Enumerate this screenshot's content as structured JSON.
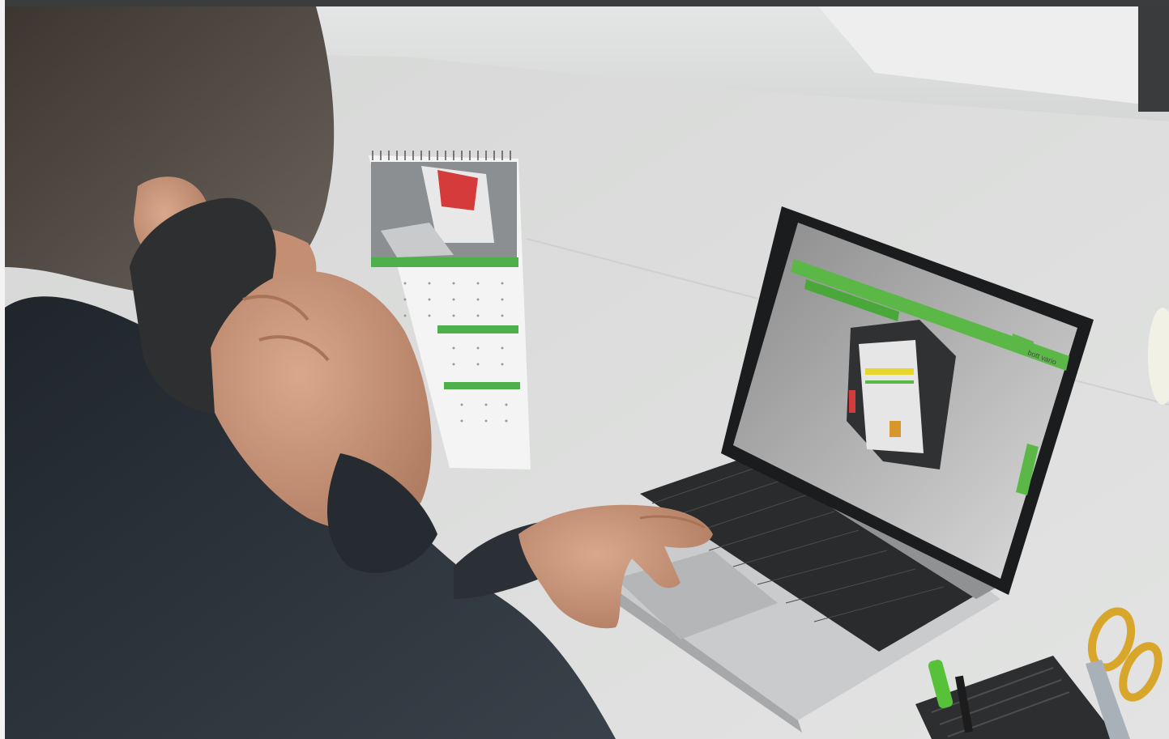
{
  "scene": {
    "description_tags": [
      "office-desk",
      "man-on-phone",
      "laptop",
      "desk-calendar",
      "pen-holder",
      "scissors"
    ]
  },
  "laptop_screen": {
    "brand_label": "bott vario",
    "accent_color": "#5bb847"
  },
  "calendar": {
    "accent_color": "#4db04a"
  },
  "colors": {
    "desk": "#dadbda",
    "wall": "#e9eaea",
    "jacket": "#2c3238",
    "skin": "#c89276",
    "laptop_body": "#c8cacb",
    "keyboard": "#2a2b2d"
  }
}
